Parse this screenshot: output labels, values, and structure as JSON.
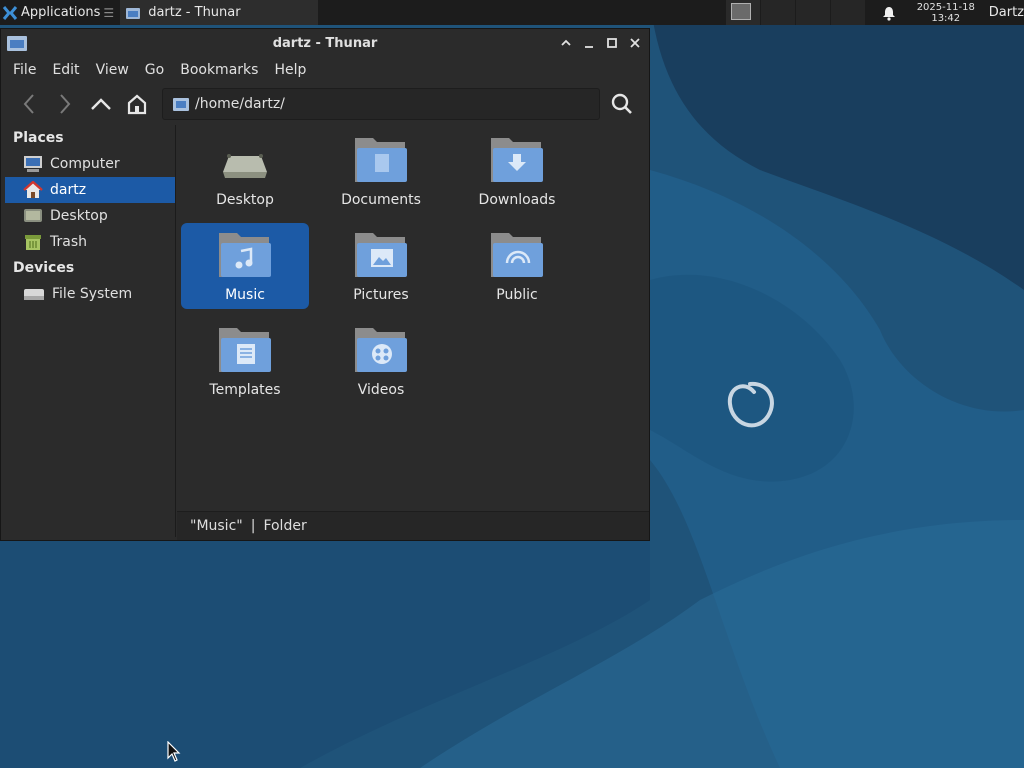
{
  "panel": {
    "app_menu_label": "Applications",
    "task_label": "dartz - Thunar",
    "clock_date": "2025-11-18",
    "clock_time": "13:42",
    "user_label": "Dartz"
  },
  "window": {
    "title": "dartz - Thunar",
    "menu": [
      "File",
      "Edit",
      "View",
      "Go",
      "Bookmarks",
      "Help"
    ],
    "path": "/home/dartz/"
  },
  "sidebar": {
    "places_header": "Places",
    "places": [
      {
        "label": "Computer",
        "icon": "computer-icon"
      },
      {
        "label": "dartz",
        "icon": "home-icon",
        "selected": true
      },
      {
        "label": "Desktop",
        "icon": "desktop-icon"
      },
      {
        "label": "Trash",
        "icon": "trash-icon"
      }
    ],
    "devices_header": "Devices",
    "devices": [
      {
        "label": "File System",
        "icon": "drive-icon"
      }
    ]
  },
  "files": [
    {
      "name": "Desktop",
      "icon": "desktop-folder-icon"
    },
    {
      "name": "Documents",
      "icon": "documents-folder-icon"
    },
    {
      "name": "Downloads",
      "icon": "downloads-folder-icon"
    },
    {
      "name": "Music",
      "icon": "music-folder-icon",
      "selected": true
    },
    {
      "name": "Pictures",
      "icon": "pictures-folder-icon"
    },
    {
      "name": "Public",
      "icon": "public-folder-icon"
    },
    {
      "name": "Templates",
      "icon": "templates-folder-icon"
    },
    {
      "name": "Videos",
      "icon": "videos-folder-icon"
    }
  ],
  "status": {
    "name": "\"Music\"",
    "sep": "|",
    "type": "Folder"
  },
  "colors": {
    "selection": "#1c5aa6",
    "window_bg": "#2b2b2b",
    "panel_bg": "#1c1c1c",
    "desktop_bg": "#1f5379"
  }
}
